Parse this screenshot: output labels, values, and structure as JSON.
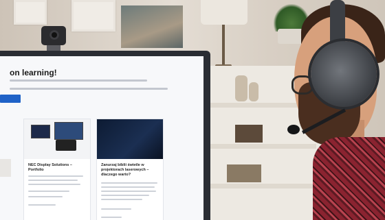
{
  "screen": {
    "hero_title": "on learning!",
    "cta_label": "",
    "cards": [
      {
        "title": "NEC Display Solutions – Portfolio"
      },
      {
        "title": "Zanurzaj biblii świetle w projektorach laserowych – dlaczego warto?"
      }
    ]
  },
  "colors": {
    "accent": "#1f62c7",
    "shirt": "#8a2330"
  },
  "icons": [
    "webcam-icon",
    "headset-icon",
    "microphone-icon"
  ]
}
